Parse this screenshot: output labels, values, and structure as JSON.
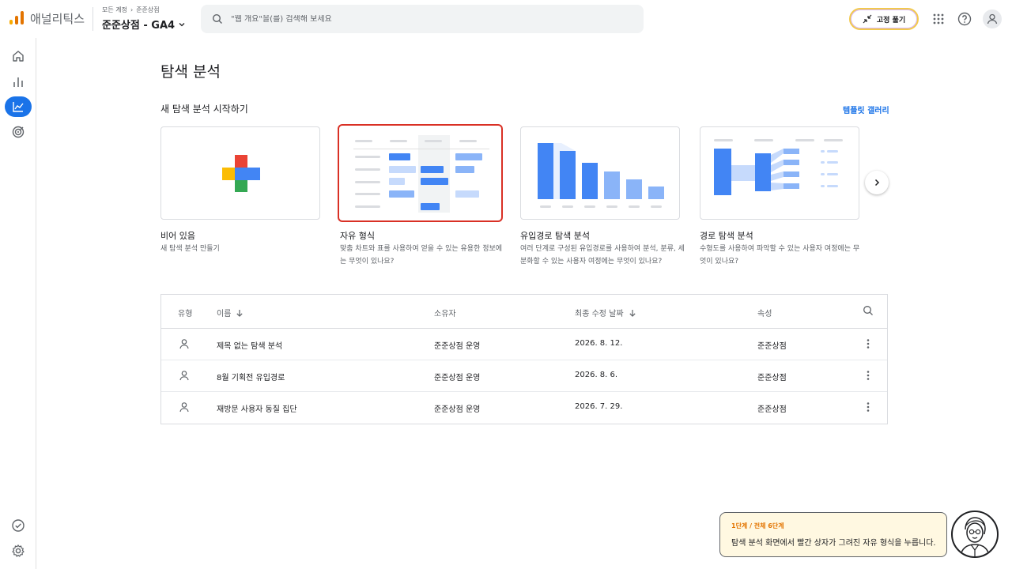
{
  "header": {
    "brand": "애널리틱스",
    "breadcrumb": [
      "모든 계정",
      "준준상점"
    ],
    "property": "준준상점 - GA4",
    "search_placeholder": "\"웹 개요\"을(를) 검색해 보세요",
    "pin_label": "고정 풀기",
    "logo_colors": [
      "#f9ab00",
      "#e37400",
      "#e37400"
    ]
  },
  "rail": {
    "items": [
      {
        "icon": "home-icon"
      },
      {
        "icon": "reports-icon"
      },
      {
        "icon": "explore-icon",
        "active": true
      },
      {
        "icon": "advertising-icon"
      }
    ],
    "bottom": [
      {
        "icon": "check-circle-icon"
      },
      {
        "icon": "gear-icon"
      }
    ]
  },
  "main": {
    "title": "탐색 분석",
    "section_title": "새 탐색 분석 시작하기",
    "gallery_link": "템플릿 갤러리",
    "templates": [
      {
        "title": "비어 있음",
        "desc": "새 탐색 분석 만들기"
      },
      {
        "title": "자유 형식",
        "desc": "맞춤 차트와 표를 사용하여 얻을 수 있는 유용한 정보에는 무엇이 있나요?",
        "selected": true
      },
      {
        "title": "유입경로 탐색 분석",
        "desc": "여러 단계로 구성된 유입경로를 사용하여 분석, 분류, 세분화할 수 있는 사용자 여정에는 무엇이 있나요?"
      },
      {
        "title": "경로 탐색 분석",
        "desc": "수형도를 사용하여 파악할 수 있는 사용자 여정에는 무엇이 있나요?"
      }
    ]
  },
  "table": {
    "headers": {
      "type": "유형",
      "name": "이름",
      "owner": "소유자",
      "modified": "최종 수정 날짜",
      "property": "속성"
    },
    "rows": [
      {
        "name": "제목 없는 탐색 분석",
        "owner": "준준상점 운영",
        "modified": "2026. 8. 12.",
        "property": "준준상점"
      },
      {
        "name": "8월 기획전 유입경로",
        "owner": "준준상점 운영",
        "modified": "2026. 8. 6.",
        "property": "준준상점"
      },
      {
        "name": "재방문 사용자 동질 집단",
        "owner": "준준상점 운영",
        "modified": "2026. 7. 29.",
        "property": "준준상점"
      }
    ]
  },
  "guide": {
    "step": "1단계 / 전체 6단계",
    "text": "탐색 분석 화면에서 빨간 상자가 그려진 자유 형식을 누릅니다."
  },
  "colors": {
    "accent": "#1a73e8",
    "selected_border": "#d93025",
    "plus_red": "#ea4335",
    "plus_yellow": "#fbbc04",
    "plus_blue": "#4285f4",
    "plus_green": "#34a853"
  }
}
